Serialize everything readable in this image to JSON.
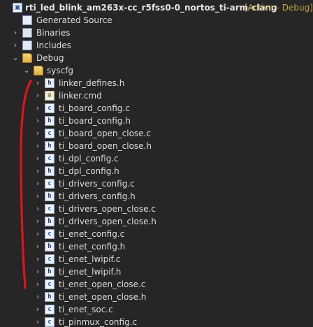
{
  "project": {
    "name": "rti_led_blink_am263x-cc_r5fss0-0_nortos_ti-arm-clang",
    "decoration": "[Active - Debug]"
  },
  "nodes": {
    "generated_source": "Generated Source",
    "binaries": "Binaries",
    "includes": "Includes",
    "debug": "Debug",
    "syscfg": "syscfg"
  },
  "chevrons": {
    "collapsed": "›",
    "expanded": "⌄"
  },
  "files": [
    {
      "name": "linker_defines.h",
      "type": "h",
      "icon_text": "h"
    },
    {
      "name": "linker.cmd",
      "type": "cmd",
      "icon_text": "≡"
    },
    {
      "name": "ti_board_config.c",
      "type": "c",
      "icon_text": "c"
    },
    {
      "name": "ti_board_config.h",
      "type": "h",
      "icon_text": "h"
    },
    {
      "name": "ti_board_open_close.c",
      "type": "c",
      "icon_text": "c"
    },
    {
      "name": "ti_board_open_close.h",
      "type": "h",
      "icon_text": "h"
    },
    {
      "name": "ti_dpl_config.c",
      "type": "c",
      "icon_text": "c"
    },
    {
      "name": "ti_dpl_config.h",
      "type": "h",
      "icon_text": "h"
    },
    {
      "name": "ti_drivers_config.c",
      "type": "c",
      "icon_text": "c"
    },
    {
      "name": "ti_drivers_config.h",
      "type": "h",
      "icon_text": "h"
    },
    {
      "name": "ti_drivers_open_close.c",
      "type": "c",
      "icon_text": "c"
    },
    {
      "name": "ti_drivers_open_close.h",
      "type": "h",
      "icon_text": "h"
    },
    {
      "name": "ti_enet_config.c",
      "type": "c",
      "icon_text": "c"
    },
    {
      "name": "ti_enet_config.h",
      "type": "h",
      "icon_text": "h"
    },
    {
      "name": "ti_enet_lwipif.c",
      "type": "c",
      "icon_text": "c"
    },
    {
      "name": "ti_enet_lwipif.h",
      "type": "h",
      "icon_text": "h"
    },
    {
      "name": "ti_enet_open_close.c",
      "type": "c",
      "icon_text": "c"
    },
    {
      "name": "ti_enet_open_close.h",
      "type": "h",
      "icon_text": "h"
    },
    {
      "name": "ti_enet_soc.c",
      "type": "c",
      "icon_text": "c"
    },
    {
      "name": "ti_pinmux_config.c",
      "type": "c",
      "icon_text": "c"
    }
  ],
  "colors": {
    "background": "#262626",
    "text": "#dcdcdc",
    "decoration": "#c8a24a",
    "annotation": "#e3121b"
  }
}
